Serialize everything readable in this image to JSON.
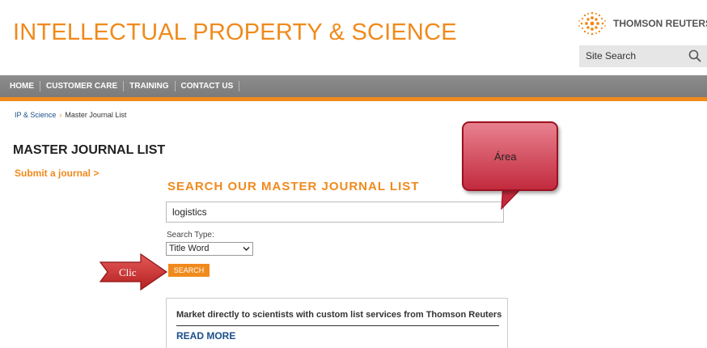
{
  "header": {
    "site_title": "INTELLECTUAL PROPERTY & SCIENCE",
    "brand_name": "THOMSON REUTERS",
    "site_search": {
      "placeholder": "Site Search"
    }
  },
  "nav": {
    "items": [
      "HOME",
      "CUSTOMER CARE",
      "TRAINING",
      "CONTACT US"
    ]
  },
  "breadcrumb": {
    "root": "IP & Science",
    "current": "Master Journal List"
  },
  "page": {
    "title": "MASTER JOURNAL LIST",
    "submit_link": "Submit a journal >"
  },
  "search_form": {
    "heading": "SEARCH OUR MASTER JOURNAL LIST",
    "query_value": "logistics",
    "type_label": "Search Type:",
    "type_selected": "Title Word",
    "submit_label": "SEARCH"
  },
  "annotations": {
    "callout_text": "Área",
    "arrow_text": "Clic",
    "callout_color": "#c22a3e",
    "arrow_color": "#d0302f"
  },
  "promo": {
    "text": "Market directly to scientists with custom list services from Thomson Reuters",
    "link": "READ MORE"
  },
  "colors": {
    "accent": "#f08a1c",
    "nav_bg": "#858585",
    "link": "#1a4f8a"
  }
}
